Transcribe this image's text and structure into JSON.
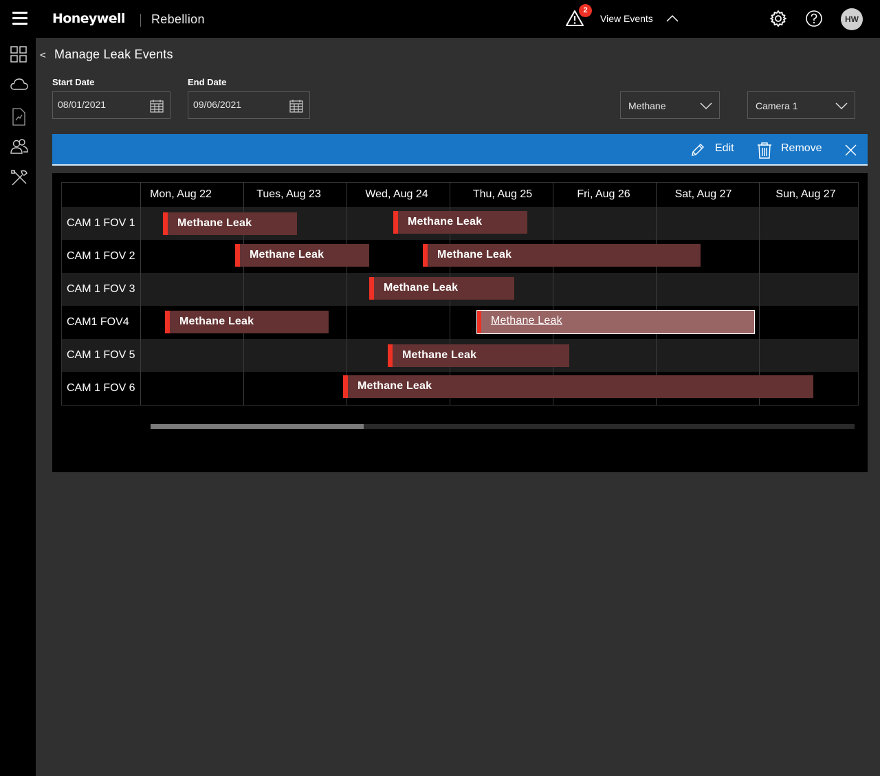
{
  "header": {
    "brand": "Honeywell",
    "product": "Rebellion",
    "alert_count": "2",
    "view_events_label": "View Events",
    "avatar_initials": "HW"
  },
  "sidebar": {
    "items": [
      {
        "icon": "dashboard-grid-icon"
      },
      {
        "icon": "cloud-icon"
      },
      {
        "icon": "report-document-icon"
      },
      {
        "icon": "users-icon"
      },
      {
        "icon": "tools-icon"
      }
    ]
  },
  "page": {
    "back_glyph": "<",
    "title": "Manage Leak Events"
  },
  "filters": {
    "start_label": "Start Date",
    "start_value": "08/01/2021",
    "end_label": "End Date",
    "end_value": "09/06/2021",
    "gas_selected": "Methane",
    "camera_selected": "Camera 1"
  },
  "actions": {
    "edit_label": "Edit",
    "remove_label": "Remove"
  },
  "gantt": {
    "days": [
      "Mon, Aug 22",
      "Tues, Aug 23",
      "Wed, Aug 24",
      "Thu, Aug 25",
      "Fri, Aug 26",
      "Sat, Aug 27",
      "Sun, Aug 27"
    ],
    "rows": [
      {
        "label": "CAM 1 FOV 1",
        "events": [
          {
            "label": "Methane Leak"
          },
          {
            "label": "Methane Leak"
          }
        ]
      },
      {
        "label": "CAM 1 FOV 2",
        "events": [
          {
            "label": "Methane Leak"
          },
          {
            "label": "Methane Leak"
          }
        ]
      },
      {
        "label": "CAM 1 FOV 3",
        "events": [
          {
            "label": "Methane Leak"
          }
        ]
      },
      {
        "label": "CAM1 FOV4",
        "events": [
          {
            "label": "Methane Leak"
          },
          {
            "label": "Methane Leak",
            "selected": true
          }
        ]
      },
      {
        "label": "CAM 1 FOV 5",
        "events": [
          {
            "label": "Methane Leak"
          }
        ]
      },
      {
        "label": "CAM 1 FOV 6",
        "events": [
          {
            "label": "Methane Leak"
          }
        ]
      }
    ]
  },
  "colors": {
    "accent_blue": "#1976c6",
    "alert_red": "#ee3124",
    "event_bar": "#643232",
    "event_bar_selected": "#996464"
  }
}
